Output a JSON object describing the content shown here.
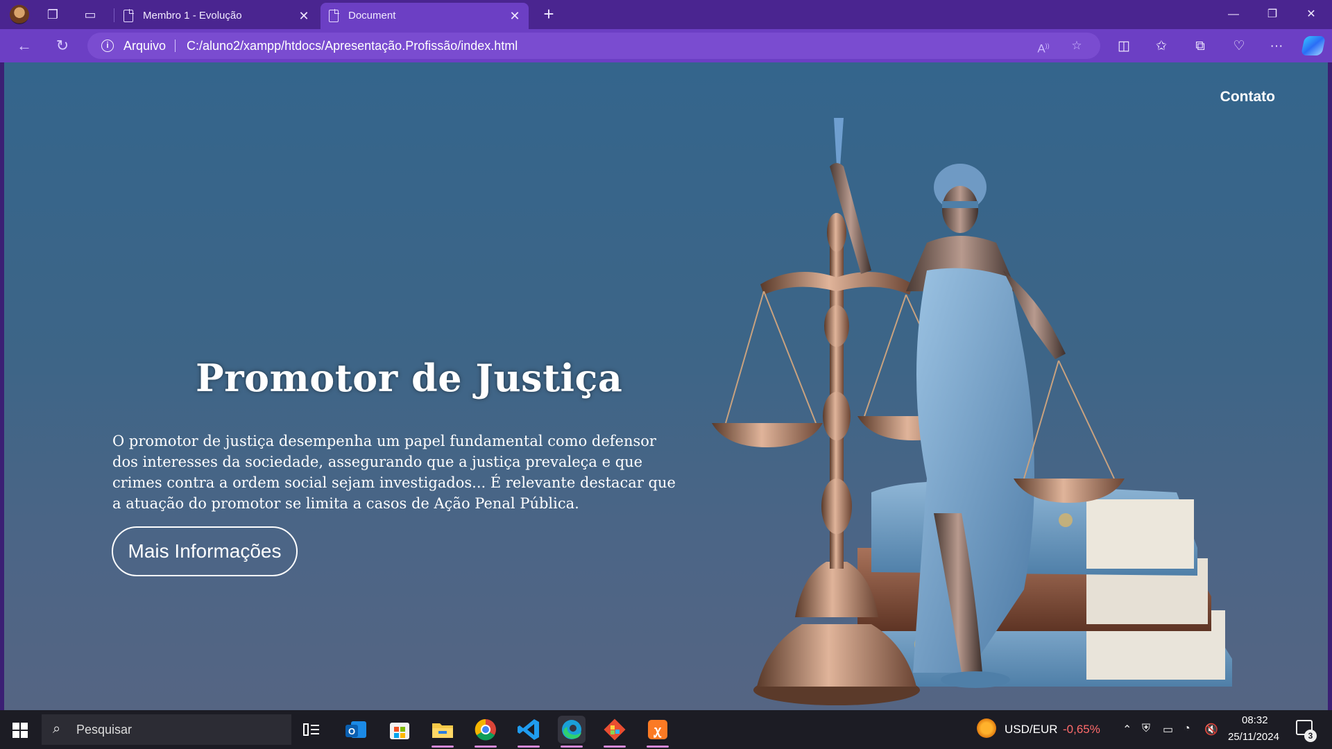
{
  "browser": {
    "tabs": [
      {
        "title": "Membro 1 - Evolução",
        "active": false
      },
      {
        "title": "Document",
        "active": true
      }
    ],
    "address": {
      "scheme_label": "Arquivo",
      "url": "C:/aluno2/xampp/htdocs/Apresentação.Profissão/index.html"
    },
    "colors": {
      "frame": "#4a2590",
      "toolbar": "#6c3fc4"
    }
  },
  "page": {
    "nav": {
      "contato": "Contato"
    },
    "hero": {
      "title": "Promotor de Justiça",
      "text": "O promotor de justiça desempenha um papel fundamental como defensor dos interesses da sociedade, assegurando que a justiça prevaleça e que crimes contra a ordem social sejam investigados... É relevante destacar que a atuação do promotor se limita a casos de Ação Penal Pública.",
      "button": "Mais Informações"
    },
    "illustration": "lady-justice-statue-with-scales-and-books"
  },
  "taskbar": {
    "search_placeholder": "Pesquisar",
    "apps": [
      "task-view",
      "outlook",
      "microsoft-store",
      "file-explorer",
      "chrome",
      "vscode",
      "edge",
      "git",
      "xampp"
    ],
    "ticker": {
      "symbol": "USD/EUR",
      "change": "-0,65%",
      "change_color": "#ff6b6b"
    },
    "clock": {
      "time": "08:32",
      "date": "25/11/2024"
    },
    "notifications": "3"
  }
}
